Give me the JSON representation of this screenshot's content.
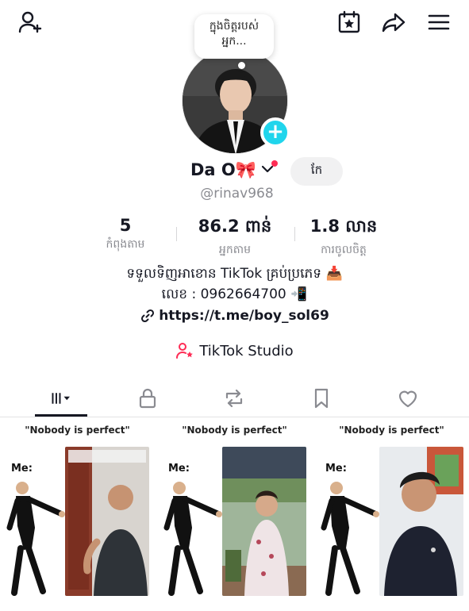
{
  "note": {
    "text": "ក្នុងចិត្តរបស់អ្នក..."
  },
  "profile": {
    "display_name": "Da O🎀",
    "edit_label": "កែ",
    "username": "@rinav968"
  },
  "stats": [
    {
      "value": "5",
      "label": "កំពុងតាម"
    },
    {
      "value": "86.2 ពាន់",
      "label": "អ្នកតាម"
    },
    {
      "value": "1.8 លាន",
      "label": "ការចូលចិត្ត"
    }
  ],
  "bio": {
    "line1": "ទទួលទិញអាខោន TikTok គ្រប់ប្រភេទ 📥",
    "line2": "លេខ : 0962664700 📲",
    "link": "https://t.me/boy_sol69"
  },
  "studio": {
    "label": "TikTok Studio"
  },
  "videos": [
    {
      "caption": "\"Nobody is perfect\"",
      "me_label": "Me:"
    },
    {
      "caption": "\"Nobody is perfect\"",
      "me_label": "Me:"
    },
    {
      "caption": "\"Nobody is perfect\"",
      "me_label": "Me:"
    }
  ],
  "icons": {
    "add_friend": "add-user-icon",
    "calendar": "calendar-star-icon",
    "share": "share-arrow-icon",
    "menu": "hamburger-menu-icon",
    "link": "link-icon",
    "studio": "studio-user-star-icon"
  },
  "colors": {
    "accent_cyan": "#20d5ec",
    "accent_red": "#fe2c55",
    "secondary_text": "#8a8b91"
  }
}
